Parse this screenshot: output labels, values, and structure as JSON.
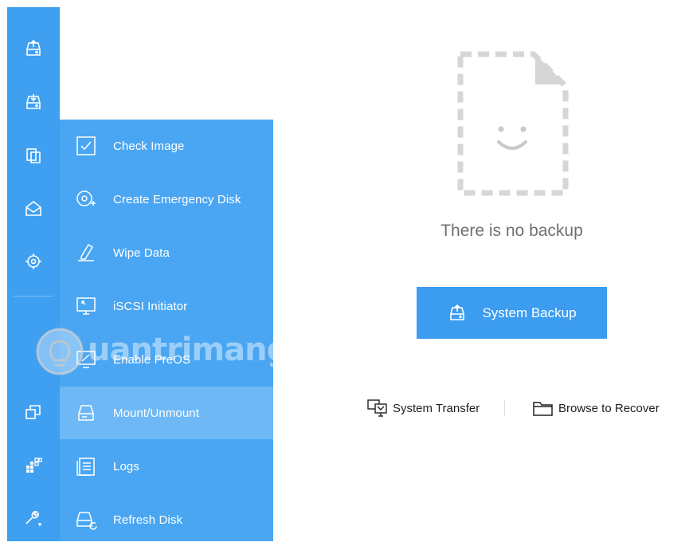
{
  "sidebar": {
    "items": [
      {
        "icon": "backup-disk-icon"
      },
      {
        "icon": "restore-disk-icon"
      },
      {
        "icon": "clone-icon"
      },
      {
        "icon": "mail-icon"
      },
      {
        "icon": "target-icon"
      },
      {
        "icon": "copy-icon"
      },
      {
        "icon": "apps-grid-icon"
      },
      {
        "icon": "tools-wrench-icon"
      }
    ]
  },
  "tools_menu": {
    "items": [
      {
        "label": "Check Image",
        "icon": "check-image-icon"
      },
      {
        "label": "Create Emergency Disk",
        "icon": "emergency-disk-icon"
      },
      {
        "label": "Wipe Data",
        "icon": "eraser-icon"
      },
      {
        "label": "iSCSI Initiator",
        "icon": "monitor-icon"
      },
      {
        "label": "Enable PreOS",
        "icon": "preos-icon"
      },
      {
        "label": "Mount/Unmount",
        "icon": "drive-icon"
      },
      {
        "label": "Logs",
        "icon": "logs-icon"
      },
      {
        "label": "Refresh Disk",
        "icon": "refresh-disk-icon"
      }
    ],
    "active_index": 5
  },
  "watermark": {
    "text": "uantrimang"
  },
  "main": {
    "empty_message": "There is no backup",
    "primary_button": "System Backup",
    "links": [
      {
        "label": "System Transfer",
        "icon": "system-transfer-icon"
      },
      {
        "label": "Browse to Recover",
        "icon": "folder-icon"
      }
    ]
  },
  "colors": {
    "sidebar": "#3f9ff0",
    "menu": "#4aa6f2",
    "menu_active": "#6db8f5",
    "primary": "#3b9cf0"
  }
}
